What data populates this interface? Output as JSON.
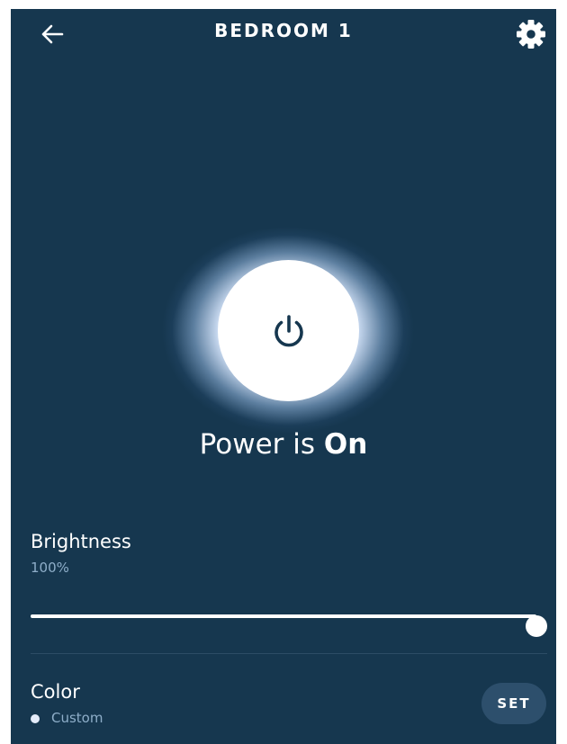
{
  "header": {
    "title": "BEDROOM 1",
    "back_icon": "arrow-left-icon",
    "settings_icon": "gear-icon"
  },
  "power": {
    "icon": "power-icon",
    "status_prefix": "Power is ",
    "status_value": "On",
    "is_on": true
  },
  "brightness": {
    "label": "Brightness",
    "value_text": "100%",
    "level": 1.0
  },
  "color": {
    "label": "Color",
    "value": "Custom",
    "swatch_color": "#e4ecfa",
    "set_label": "SET"
  },
  "theme": {
    "background": "#16374f",
    "accent": "#ffffff",
    "muted_text": "#8eaec9"
  }
}
